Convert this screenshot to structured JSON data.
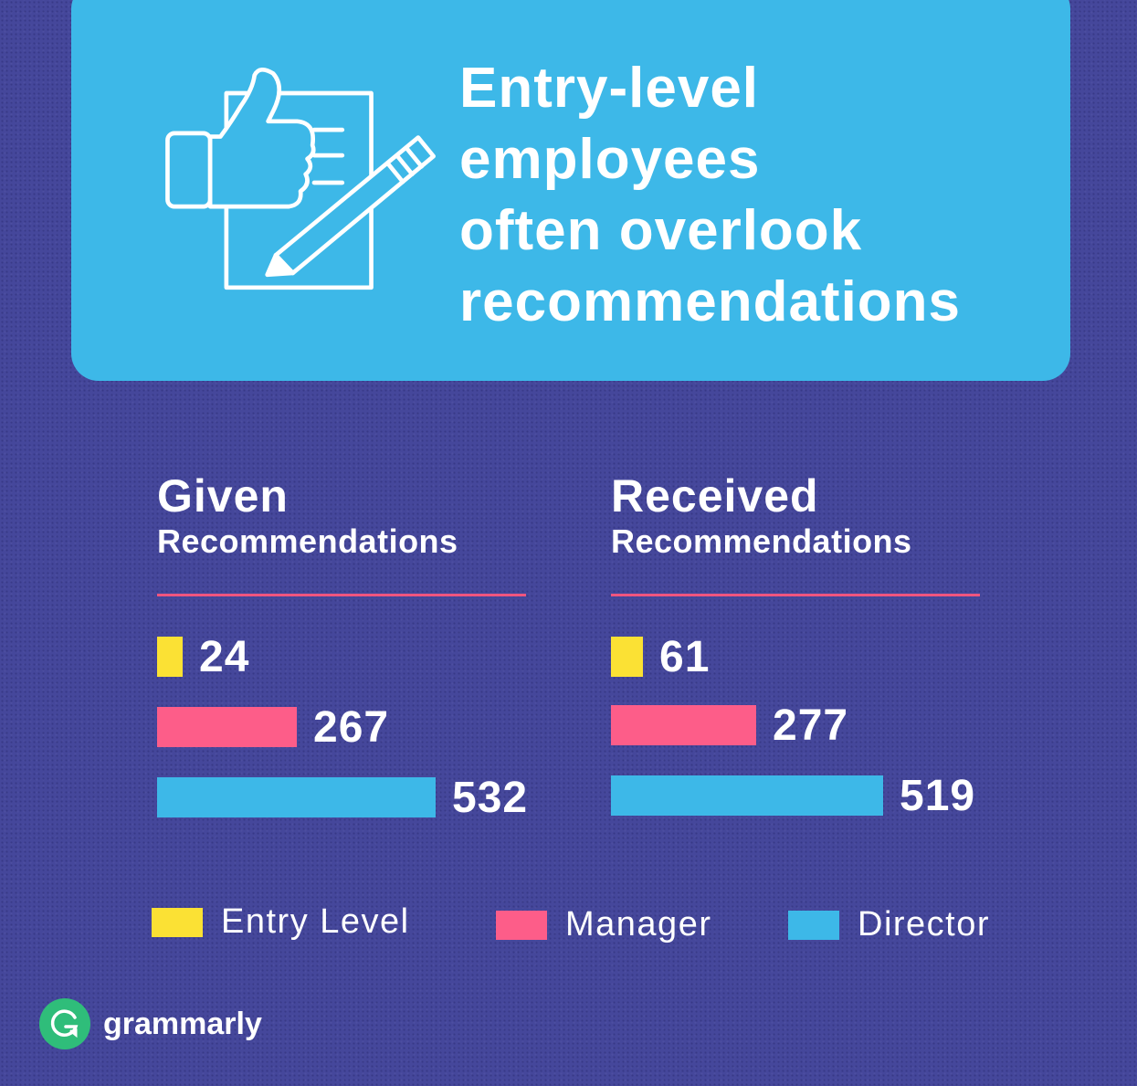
{
  "header": {
    "title_lines": [
      "Entry-level",
      "employees",
      "often overlook",
      "recommendations"
    ],
    "icon": "thumbs-up-document-pencil-icon"
  },
  "colors": {
    "background": "#45479b",
    "header_card": "#3db8e8",
    "entry_level": "#fbe134",
    "manager": "#fd5d89",
    "director": "#3db8e8",
    "divider": "#f0557f",
    "logo_green": "#2fbd7a"
  },
  "chart_data": [
    {
      "type": "bar",
      "orientation": "horizontal",
      "title": "Given",
      "subtitle": "Recommendations",
      "categories": [
        "Entry Level",
        "Manager",
        "Director"
      ],
      "values": [
        24,
        267,
        532
      ],
      "value_labels": [
        "24",
        "267",
        "532"
      ]
    },
    {
      "type": "bar",
      "orientation": "horizontal",
      "title": "Received",
      "subtitle": "Recommendations",
      "categories": [
        "Entry Level",
        "Manager",
        "Director"
      ],
      "values": [
        61,
        277,
        519
      ],
      "value_labels": [
        "61",
        "277",
        "519"
      ]
    }
  ],
  "legend": [
    {
      "label": "Entry Level",
      "color": "#fbe134"
    },
    {
      "label": "Manager",
      "color": "#fd5d89"
    },
    {
      "label": "Director",
      "color": "#3db8e8"
    }
  ],
  "brand": {
    "name": "grammarly",
    "logo_letter": "G"
  }
}
